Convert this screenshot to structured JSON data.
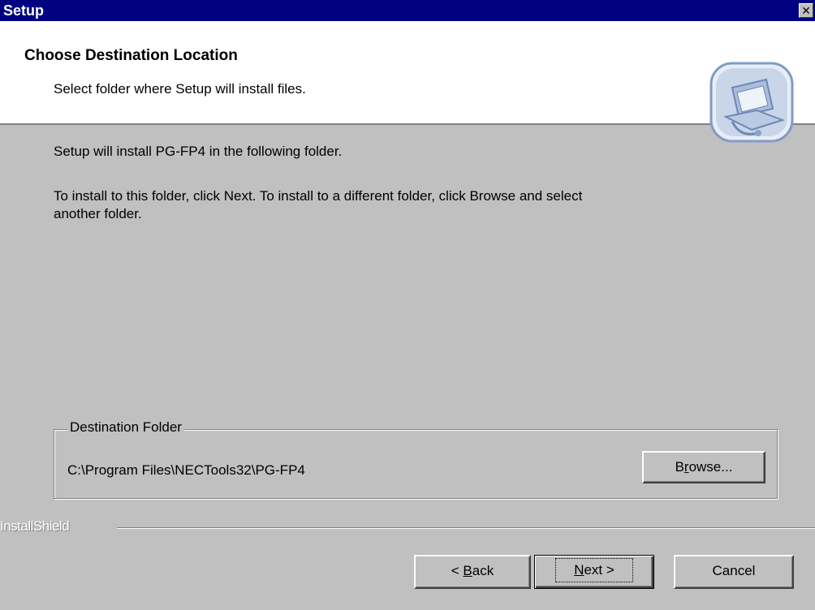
{
  "window": {
    "title": "Setup",
    "close_glyph": "✕"
  },
  "header": {
    "title": "Choose Destination Location",
    "subtitle": "Select folder where Setup will install files.",
    "icon": "computer-setup-icon"
  },
  "body": {
    "line1": "Setup will install PG-FP4 in the following folder.",
    "line2a": "To install to this folder, click Next. To install to a different folder, click Browse and select",
    "line2b": "another folder."
  },
  "destination": {
    "legend": "Destination Folder",
    "path": "C:\\Program Files\\NECTools32\\PG-FP4",
    "browse_pre": "B",
    "browse_accel": "r",
    "browse_post": "owse..."
  },
  "footer": {
    "brand": "InstallShield",
    "back_pre": "< ",
    "back_accel": "B",
    "back_post": "ack",
    "next_accel": "N",
    "next_post": "ext >",
    "cancel_label": "Cancel"
  },
  "colors": {
    "titlebar": "#000080",
    "dialog": "#c0c0c0",
    "header_bg": "#ffffff"
  }
}
